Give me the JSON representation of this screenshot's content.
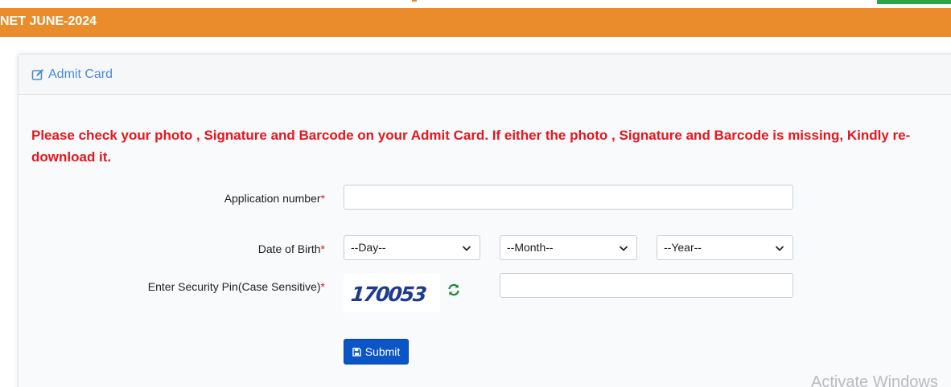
{
  "banner": {
    "title": "NET JUNE-2024"
  },
  "card": {
    "header_title": "Admit Card",
    "notice": "Please check your photo , Signature and Barcode on your Admit Card. If either the photo , Signature and Barcode is missing, Kindly re-download it."
  },
  "form": {
    "application_number": {
      "label": "Application number",
      "required_mark": "*",
      "value": ""
    },
    "dob": {
      "label": "Date of Birth",
      "required_mark": "*",
      "day_selected": "--Day--",
      "month_selected": "--Month--",
      "year_selected": "--Year--"
    },
    "security_pin": {
      "label": "Enter Security Pin(Case Sensitive)",
      "required_mark": "*",
      "captcha_text": "170053",
      "value": ""
    },
    "submit_label": "Submit"
  },
  "watermark": "Activate Windows",
  "colors": {
    "banner": "#ea8c2c",
    "notice": "#e8161c",
    "accent": "#4a8ad6",
    "submit": "#0b55c6",
    "refresh": "#1e8a2e"
  },
  "icons": {
    "header": "edit-icon",
    "refresh": "refresh-icon",
    "submit": "save-icon",
    "select": "chevron-down-icon"
  }
}
